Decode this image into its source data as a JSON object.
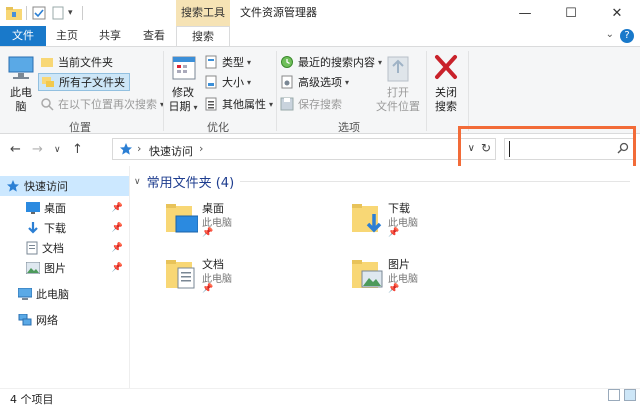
{
  "title_bar": {
    "context_tab_title": "搜索工具",
    "window_title": "文件资源管理器",
    "minimize_glyph": "—",
    "maximize_glyph": "☐",
    "close_glyph": "✕"
  },
  "tabs": [
    {
      "label": "文件"
    },
    {
      "label": "主页"
    },
    {
      "label": "共享"
    },
    {
      "label": "查看"
    },
    {
      "label": "搜索"
    }
  ],
  "ribbon_toggle_glyph": "⌄",
  "help_glyph": "?",
  "ribbon": {
    "location": {
      "group_label": "位置",
      "this_pc": "此电\n脑",
      "current_folder": "当前文件夹",
      "all_subfolders": "所有子文件夹",
      "search_again": "在以下位置再次搜索"
    },
    "refine": {
      "group_label": "优化",
      "date_modified": "修改\n日期",
      "kind": "类型",
      "size": "大小",
      "other_properties": "其他属性"
    },
    "options": {
      "group_label": "选项",
      "recent_searches": "最近的搜索内容",
      "advanced_options": "高级选项",
      "save_search": "保存搜索",
      "open_location": "打开\n文件位置"
    },
    "close": {
      "close_search": "关闭\n搜索"
    }
  },
  "address": {
    "breadcrumb_sep": "›",
    "location": "快速访问",
    "trail_sep": "›",
    "dropdown_glyph": "∨",
    "refresh_glyph": "↻"
  },
  "search": {
    "placeholder": "",
    "value": ""
  },
  "nav_pane": {
    "quick_access": "快速访问",
    "items": [
      {
        "label": "桌面",
        "pinned": true
      },
      {
        "label": "下载",
        "pinned": true
      },
      {
        "label": "文档",
        "pinned": true
      },
      {
        "label": "图片",
        "pinned": true
      }
    ],
    "this_pc": "此电脑",
    "network": "网络"
  },
  "content": {
    "group_header": "常用文件夹 (4)",
    "folders": [
      {
        "name": "桌面",
        "location": "此电脑"
      },
      {
        "name": "下载",
        "location": "此电脑"
      },
      {
        "name": "文档",
        "location": "此电脑"
      },
      {
        "name": "图片",
        "location": "此电脑"
      }
    ]
  },
  "status_bar": {
    "item_count": "4 个项目"
  },
  "colors": {
    "accent": "#1979ca",
    "context_tab": "#f6e3b5",
    "highlight": "#f26b38",
    "folder": "#f8d775",
    "group_header": "#1e3d8f"
  }
}
